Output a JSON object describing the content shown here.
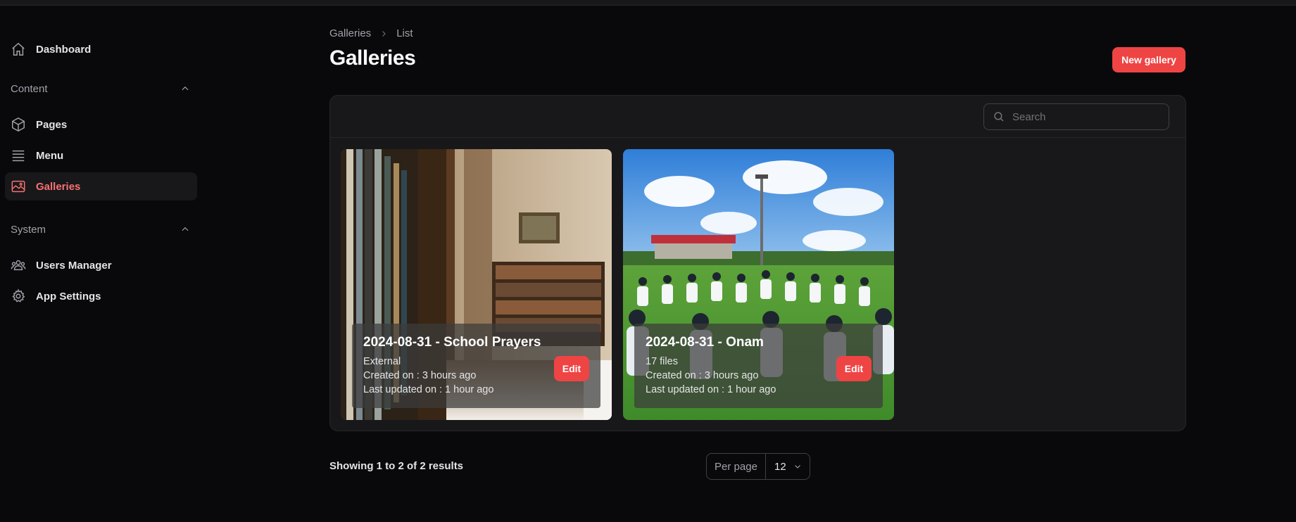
{
  "sidebar": {
    "dashboard": "Dashboard",
    "groups": [
      {
        "label": "Content",
        "items": [
          "Pages",
          "Menu",
          "Galleries"
        ]
      },
      {
        "label": "System",
        "items": [
          "Users Manager",
          "App Settings"
        ]
      }
    ],
    "active_item": "Galleries"
  },
  "breadcrumb": {
    "root": "Galleries",
    "current": "List"
  },
  "page": {
    "title": "Galleries",
    "new_button": "New gallery"
  },
  "search": {
    "placeholder": "Search"
  },
  "cards": [
    {
      "title": "2024-08-31 - School Prayers",
      "line1": "External",
      "created": "Created on : 3 hours ago",
      "updated": "Last updated on : 1 hour ago",
      "edit_label": "Edit"
    },
    {
      "title": "2024-08-31 - Onam",
      "line1": "17 files",
      "created": "Created on : 3 hours ago",
      "updated": "Last updated on : 1 hour ago",
      "edit_label": "Edit"
    }
  ],
  "footer": {
    "results": "Showing 1 to 2 of 2 results",
    "per_page_label": "Per page",
    "per_page_value": "12"
  },
  "colors": {
    "accent": "#ef4444",
    "active_text": "#f87171",
    "background": "#09090b",
    "panel": "#18181b"
  }
}
